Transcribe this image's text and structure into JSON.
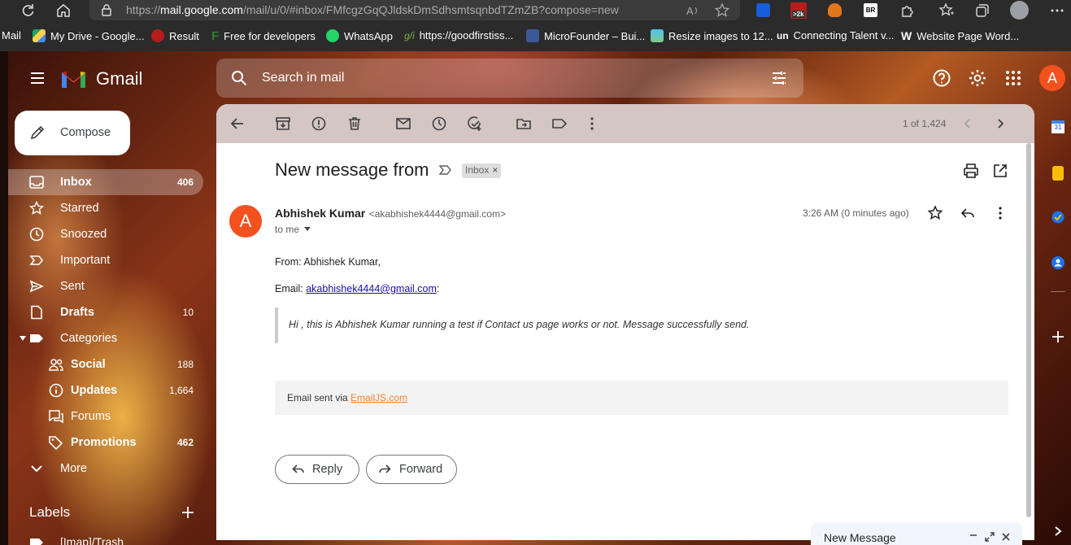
{
  "browser": {
    "url_prefix": "https://",
    "url_host": "mail.google.com",
    "url_path": "/mail/u/0/#inbox/FMfcgzGqQJldskDmSdhsmtsqnbdTZmZB?compose=new",
    "ext_badge": ">2k",
    "ext_br": "BR"
  },
  "bookmarks": [
    {
      "label": "Mail",
      "color": "#2b2b2b"
    },
    {
      "label": "My Drive - Google...",
      "color": "#1fa463"
    },
    {
      "label": "Result",
      "color": "#b71c1c"
    },
    {
      "label": "Free for developers",
      "color": "#2e7d32"
    },
    {
      "label": "WhatsApp",
      "color": "#25d366"
    },
    {
      "label": "https://goodfirstiss...",
      "color": "#5f8f3a"
    },
    {
      "label": "MicroFounder – Bui...",
      "color": "#3b5998"
    },
    {
      "label": "Resize images to 12...",
      "color": "#4fc3f7"
    },
    {
      "label": "Connecting Talent v...",
      "color": "#1a237e"
    },
    {
      "label": "Website Page Word...",
      "color": "#ffffff"
    }
  ],
  "gmail": {
    "brand": "Gmail",
    "search_placeholder": "Search in mail",
    "avatar_letter": "A",
    "compose_label": "Compose"
  },
  "sidebar": {
    "items": [
      {
        "label": "Inbox",
        "count": "406"
      },
      {
        "label": "Starred",
        "count": ""
      },
      {
        "label": "Snoozed",
        "count": ""
      },
      {
        "label": "Important",
        "count": ""
      },
      {
        "label": "Sent",
        "count": ""
      },
      {
        "label": "Drafts",
        "count": "10"
      },
      {
        "label": "Categories",
        "count": ""
      },
      {
        "label": "Social",
        "count": "188"
      },
      {
        "label": "Updates",
        "count": "1,664"
      },
      {
        "label": "Forums",
        "count": ""
      },
      {
        "label": "Promotions",
        "count": "462"
      },
      {
        "label": "More",
        "count": ""
      }
    ],
    "labels_heading": "Labels",
    "label_first": "[Imap]/Trash"
  },
  "toolbar": {
    "pagination": "1 of 1,424"
  },
  "email": {
    "subject": "New message from",
    "inbox_chip": "Inbox",
    "sender_name": "Abhishek Kumar",
    "sender_email": "<akabhishek4444@gmail.com>",
    "recipient": "to me",
    "time": "3:26 AM (0 minutes ago)",
    "avatar_letter": "A",
    "from_line": "From: Abhishek Kumar,",
    "email_label": "Email:",
    "email_link": "akabhishek4444@gmail.com",
    "email_suffix": ":",
    "quote": "Hi , this is Abhishek Kumar running a test if Contact us page works or not. Message successfully send.",
    "footer_prefix": "Email sent via ",
    "footer_link": "EmailJS.com",
    "reply_label": "Reply",
    "forward_label": "Forward"
  },
  "new_message": {
    "title": "New Message"
  },
  "colors": {
    "gmail_red": "#ea4335",
    "avatar_orange": "#f4511e",
    "active_blue": "#1a73e8",
    "emailjs_orange": "#f4842d"
  }
}
